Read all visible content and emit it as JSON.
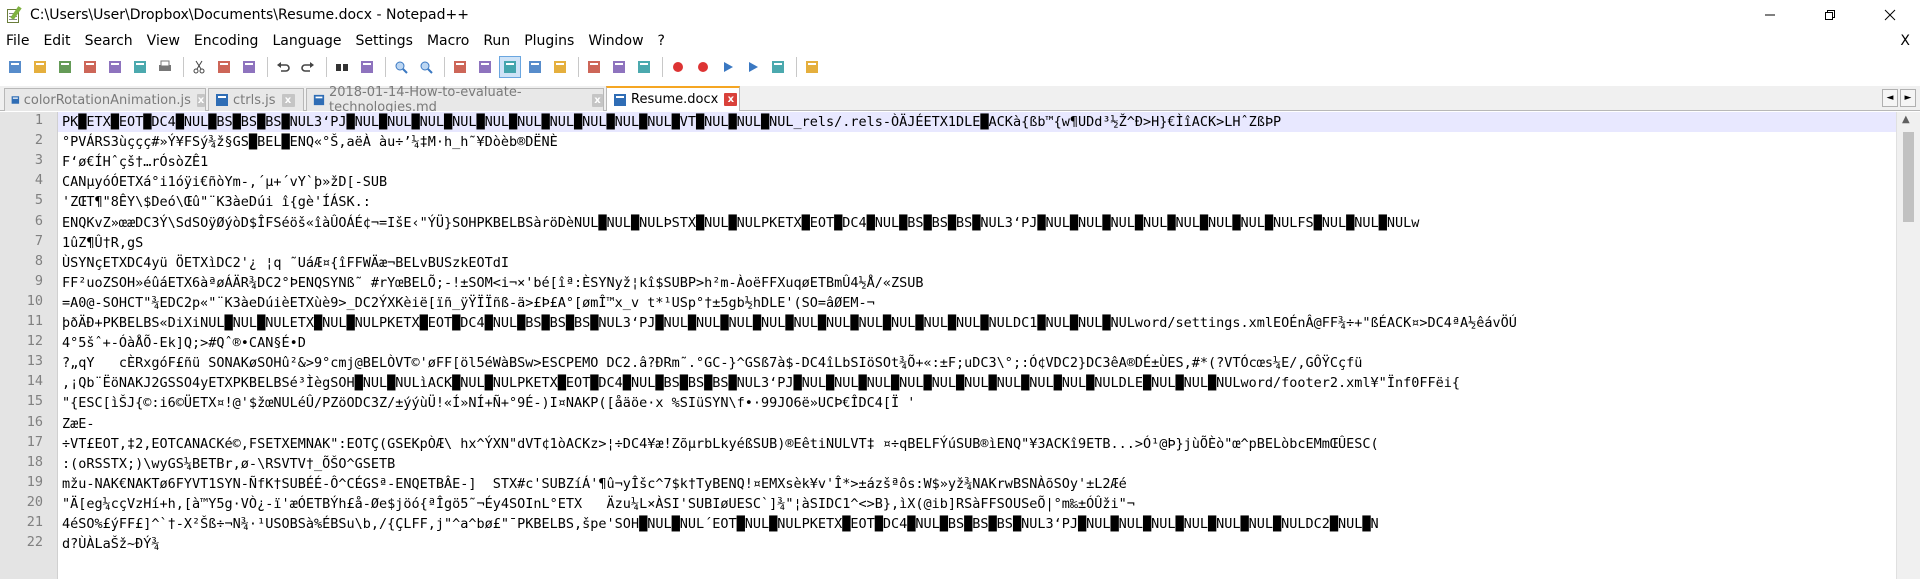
{
  "window": {
    "title": "C:\\Users\\User\\Dropbox\\Documents\\Resume.docx - Notepad++",
    "minimize_glyph": "—",
    "maximize_glyph": "☐",
    "close_glyph": "✕"
  },
  "menu": {
    "items": [
      "File",
      "Edit",
      "Search",
      "View",
      "Encoding",
      "Language",
      "Settings",
      "Macro",
      "Run",
      "Plugins",
      "Window",
      "?"
    ],
    "close_glyph": "X"
  },
  "toolbar": {
    "buttons": [
      "new-file-icon",
      "open-file-icon",
      "save-icon",
      "save-all-icon",
      "close-icon",
      "close-all-icon",
      "print-icon",
      "sep",
      "cut-icon",
      "copy-icon",
      "paste-icon",
      "sep",
      "undo-icon",
      "redo-icon",
      "sep",
      "find-icon",
      "replace-icon",
      "sep",
      "zoom-in-icon",
      "zoom-out-icon",
      "sep",
      "sync-vertical-icon",
      "sync-horizontal-icon",
      "word-wrap-icon",
      "show-all-chars-icon",
      "indent-guide-icon",
      "sep",
      "doc-map-icon",
      "function-list-icon",
      "folder-workspace-icon",
      "sep",
      "record-macro-icon",
      "stop-record-icon",
      "play-macro-icon",
      "play-multiple-icon",
      "save-macro-icon",
      "sep",
      "monitor-icon"
    ],
    "active": "word-wrap-icon"
  },
  "tabs": [
    {
      "label": "colorRotationAnimation.js",
      "close": "x",
      "active": false
    },
    {
      "label": "ctrls.js",
      "close": "x",
      "active": false
    },
    {
      "label": "2018-01-14-How-to-evaluate-technologies.md",
      "close": "x",
      "active": false
    },
    {
      "label": "Resume.docx",
      "close": "x",
      "active": true
    }
  ],
  "tab_arrows": {
    "left": "◄",
    "right": "►"
  },
  "editor": {
    "current_line": 1,
    "scroll_up_glyph": "▲",
    "lines": [
      {
        "n": "1",
        "text": "PK█ETX█EOT█DC4█NUL█BS█BS█BS█NUL3‘PJ█NUL█NUL█NUL█NUL█NUL█NUL█NUL█NUL█NUL█NUL█VT█NUL█NUL█NUL_rels/.rels-ÒÄJÉETX1DLE█ACKà{ßb™{w¶UDd³½Ž^Ð>H}€ÌîACK>LHˆZßÞP"
      },
      {
        "n": "2",
        "text": "°PVÁRS3ùççç#»Ý¥FSý¾ž§GS█BEL█ENQ«°Š,aëÀ àu÷’¼‡M·h_h˜¥Dòèb®DËNÈ"
      },
      {
        "n": "3",
        "text": "F‘ø€ÍHˆçš†…rÓsòZÊ1"
      },
      {
        "n": "4",
        "text": "CANµyóÓETXá°i1óÿi€ñòYm-,´µ+´vY`þ»žD[-SUB"
      },
      {
        "n": "5",
        "text": "'ZŒT¶\"8ÊY\\$Deó\\Œû\"¨K3àeDúi î{gè'ÍÁSK.:"
      },
      {
        "n": "6",
        "text": "ENQKvZ»œæDC3Ý\\SdSOÿØýòD$ÎFSéöš«îàÛOÁÉ¢¬=IšE‹\"ÝÜ}SOHPKBELBSàröDèNUL█NUL█NULÞSTX█NUL█NULPKETX█EOT█DC4█NUL█BS█BS█BS█NUL3‘PJ█NUL█NUL█NUL█NUL█NUL█NUL█NUL█NULFS█NUL█NUL█NULw"
      },
      {
        "n": "7",
        "text": "1ûZ¶Û†R,gS"
      },
      {
        "n": "8",
        "text": "ÙSYNçETXDC4yü ÖETXìDC2'¿ ¦q ˜UáÆ¤{îFFWÄæ¬BELvBUSzkEOTdI"
      },
      {
        "n": "9",
        "text": "FF²uoZSOH»éûáETX6àªøÁÄR¾DC2°ÞENQSYNß˜ #rYœBELÕ;-!±SOM<i¬×'bé[îª:ÈSYNyž¦kî$SUBP>h²m-ÀoëFFXuqøETBmÛ4½Å/«ZSUB"
      },
      {
        "n": "10",
        "text": "=A0@-SOHCT\"¾EDC2p«\"¨K3àeDúièETXùè9>_DC2ÝXKèië[ïñ_ÿŸÏÏñß-ä>£Þ£A°[ømÎ™x_v t*¹USp°†±5gb½hDLE'(SO=âØEM-¬"
      },
      {
        "n": "11",
        "text": "þðÄÐ+PKBELBS«DiXiNUL█NUL█NULETX█NUL█NULPKETX█EOT█DC4█NUL█BS█BS█BS█NUL3‘PJ█NUL█NUL█NUL█NUL█NUL█NUL█NUL█NUL█NUL█NUL█NULDC1█NUL█NUL█NULword/settings.xmlEOÉnÂ@FF¾÷+\"ßÉACK¤>DC4ªA½êávÖÚ"
      },
      {
        "n": "12",
        "text": "4°5šˆ+-ÓàÅÕ-Ek]Q;>#Qˆ®•CAN§É•D"
      },
      {
        "n": "13",
        "text": "?„qY   cÈRxgóF£ñü SONAKøSOHû²&>9°cmj@BELÒVT©'øFF[öl5éWàBSw>ESCPEMO DC2.â?ÐRm˜.°GC-}^GSß7à$-DC4îLbSIöSOt¾Õ+«:±F;uDC3\\°;:Ó¢VDC2}DC3êA®DÉ±ÙES,#*(?VTÓcœs¼E/,GÔŸCçfü"
      },
      {
        "n": "14",
        "text": ",¡Qb¨ËöNAKJ2GSSO4yETXPKBELBSé³ÌègSOH█NUL█NULìACK█NUL█NULPKETX█EOT█DC4█NUL█BS█BS█BS█NUL3‘PJ█NUL█NUL█NUL█NUL█NUL█NUL█NUL█NUL█NUL█NULDLE█NUL█NUL█NULword/footer2.xml¥\"Ïnf0FFëi{"
      },
      {
        "n": "15",
        "text": "\"{ESC[ìŠJ{©:i6©ÜETX¤!@'$žœNULéÛ/PZöODC3Z/±ýýùÜ!«Í»NÍ+Ñ+°9É-)I¤NAKP([åäöe·x %SIüSYN\\f•·99JO6ë»UCÞ€ÎDC4[Ï '"
      },
      {
        "n": "16",
        "text": "ZæE-"
      },
      {
        "n": "17",
        "text": "÷VT£EOT,‡2,EOTCANACKé©,FSETXEMNAK\":EOTÇ(GSEKpÒÆ\\ hx^ÝXN\"dVT¢1òACKz>¦÷DC4¥æ!ZõµrbLkyéßSUB)®EêtiNULVT‡ ¤÷qBELFÝúSUB®ìENQ\"¥3ACKî9ETB...>Ó¹@Þ}jùÕÈò\"œ^pBELòbcEMmŒÛESC("
      },
      {
        "n": "18",
        "text": ":(oRSSTX;)\\wyGS¼BETBr,ø-\\RSVTV†_ÕŠO^GSETB"
      },
      {
        "n": "19",
        "text": "mžu-NAK€NAKTø6FYVT1SYN-ÑfK†SUBÉÉ-Ô^CÉGSª-ENQETBÂE-]  STX#c'SUBZíÁ'¶û¬yÎšc^7$k†TyBENQ!¤EMXsèk¥v'Î*>±ázšªôs:W$»yž¾NAKrwBSNÀõSOy'±L2Æé"
      },
      {
        "n": "20",
        "text": "\"Ä[eg¼cçVzHí+h,[à™Y5g·VÒ¿-ï'æÓETBÝh£å-Øe$jöó{ªÎgö5˜¬Éy4SOInL°ETX   Äzu¼L×ÀSI'SUBIøUESC`]¾\"¦àSIDC1^<>B},ìX(@ib]RSàFFSOUSeÕ|°m‰±ÓÛži\"¬"
      },
      {
        "n": "21",
        "text": "4éSO%£ýFF£]^`†-X²Šß÷¬N¾·¹USOBSà%ÉBSu\\b,/{ÇLFF,j\"^a^bø£\"¯PKBELBS,špe'SOH█NUL█NUL´EOT█NUL█NULPKETX█EOT█DC4█NUL█BS█BS█BS█NUL3‘PJ█NUL█NUL█NUL█NUL█NUL█NUL█NULDC2█NUL█N"
      },
      {
        "n": "22",
        "text": "d?ÙÀLaŠž~ÐÝ¾"
      }
    ]
  }
}
